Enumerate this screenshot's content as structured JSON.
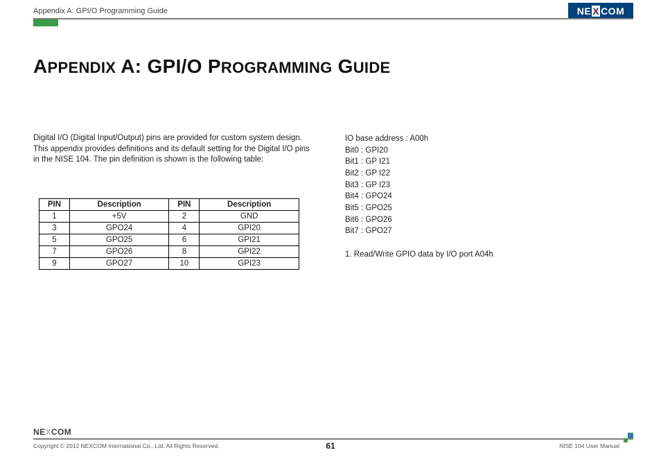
{
  "header": {
    "breadcrumb": "Appendix A: GPI/O Programming Guide",
    "brand_left": "NE",
    "brand_mid": "X",
    "brand_right": "COM"
  },
  "title": {
    "w1big": "A",
    "w1sm": "ppendix",
    "w2": "A:",
    "w3": "GPI/O",
    "w4big": "P",
    "w4sm": "rogramming",
    "w5big": "G",
    "w5sm": "uide"
  },
  "intro": "Digital I/O (Digital Input/Output) pins are provided for custom system design. This appendix provides definitions and its default setting for the Digital I/O pins in the NISE 104. The pin definition is shown is the following table:",
  "table": {
    "headers": {
      "pin": "PIN",
      "desc": "Description"
    },
    "rows": [
      {
        "p1": "1",
        "d1": "+5V",
        "p2": "2",
        "d2": "GND"
      },
      {
        "p1": "3",
        "d1": "GPO24",
        "p2": "4",
        "d2": "GPI20"
      },
      {
        "p1": "5",
        "d1": "GPO25",
        "p2": "6",
        "d2": "GPI21"
      },
      {
        "p1": "7",
        "d1": "GPO26",
        "p2": "8",
        "d2": "GPI22"
      },
      {
        "p1": "9",
        "d1": "GPO27",
        "p2": "10",
        "d2": "GPI23"
      }
    ]
  },
  "info": {
    "lines": [
      "IO base address : A00h",
      "Bit0 : GPI20",
      "Bit1 : GP I21",
      "Bit2 : GP I22",
      "Bit3 : GP I23",
      "Bit4 : GPO24",
      "Bit5 : GPO25",
      "Bit6 : GPO26",
      "Bit7 : GPO27",
      "",
      "1. Read/Write GPIO data by I/O port A04h"
    ]
  },
  "footer": {
    "brand": "NE",
    "brand_x": "X",
    "brand_end": "COM",
    "copyright": "Copyright © 2012 NEXCOM International Co., Ltd. All Rights Reserved.",
    "page": "61",
    "manual": "NISE 104 User Manual"
  }
}
